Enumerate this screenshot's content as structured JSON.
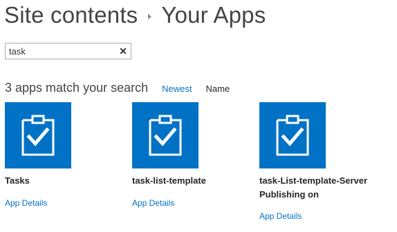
{
  "breadcrumb": {
    "parent": "Site contents",
    "current": "Your Apps"
  },
  "search": {
    "value": "task",
    "clear_symbol": "✕"
  },
  "results": {
    "count_text": "3 apps match your search",
    "sort_newest": "Newest",
    "sort_name": "Name"
  },
  "apps": [
    {
      "title": "Tasks",
      "details_label": "App Details",
      "icon": "clipboard-check-icon"
    },
    {
      "title": "task-list-template",
      "details_label": "App Details",
      "icon": "clipboard-check-icon"
    },
    {
      "title": "task-List-template-Server Publishing on",
      "details_label": "App Details",
      "icon": "clipboard-check-icon"
    }
  ],
  "colors": {
    "tile": "#0072c6",
    "link": "#0072c6",
    "text": "#444444"
  }
}
